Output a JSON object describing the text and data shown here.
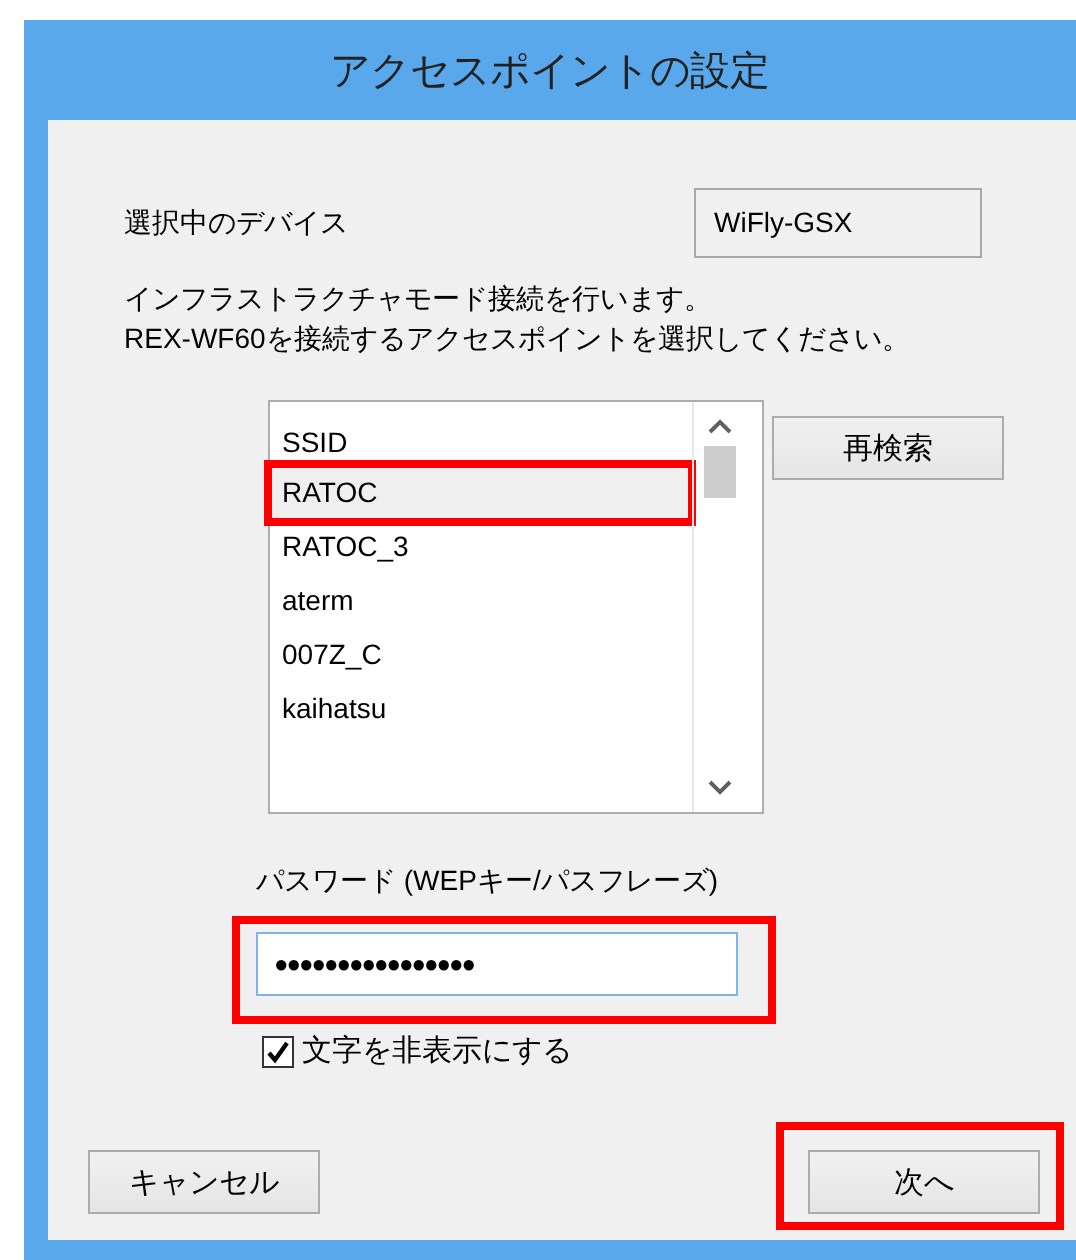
{
  "window": {
    "title": "アクセスポイントの設定"
  },
  "device": {
    "label": "選択中のデバイス",
    "value": "WiFly-GSX"
  },
  "description_lines": [
    "インフラストラクチャモード接続を行います。",
    "REX-WF60を接続するアクセスポイントを選択してください。"
  ],
  "ssid_list": {
    "column_header": "SSID",
    "items": [
      {
        "name": "RATOC",
        "selected": true,
        "highlighted": true
      },
      {
        "name": "RATOC_3",
        "selected": false,
        "highlighted": false
      },
      {
        "name": "aterm",
        "selected": false,
        "highlighted": false
      },
      {
        "name": "007Z_C",
        "selected": false,
        "highlighted": false
      },
      {
        "name": "kaihatsu",
        "selected": false,
        "highlighted": false
      }
    ]
  },
  "rescan_button": {
    "label": "再検索",
    "highlighted": false
  },
  "password": {
    "label": "パスワード (WEPキー/パスフレーズ)",
    "value": "●●●●●●●●●●●●●●●●",
    "highlighted": true
  },
  "hide_characters": {
    "label": "文字を非表示にする",
    "checked": true
  },
  "buttons": [
    {
      "label": "キャンセル",
      "highlighted": false
    },
    {
      "label": "次へ",
      "highlighted": true
    }
  ]
}
